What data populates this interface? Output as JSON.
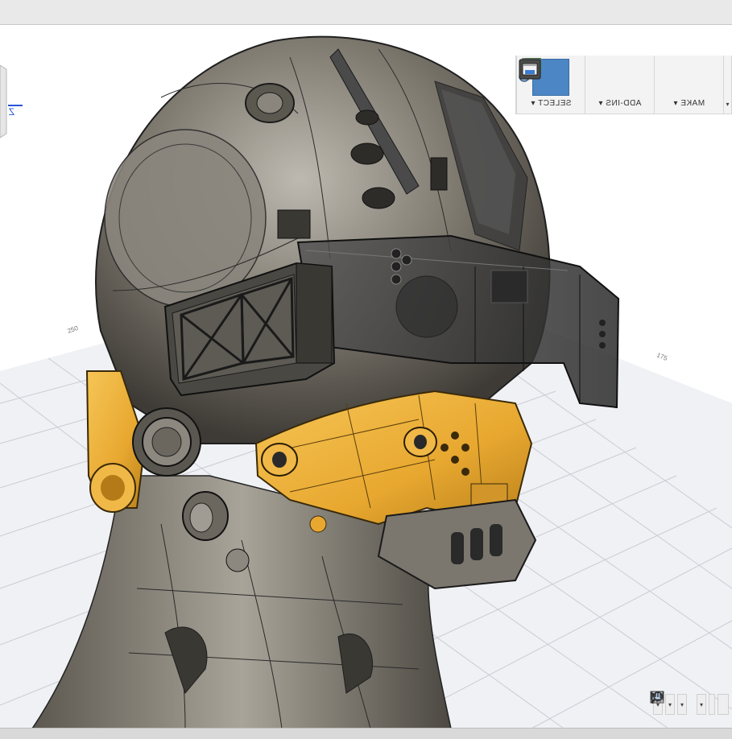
{
  "window": {
    "title": ""
  },
  "toolbar": {
    "groups": [
      {
        "label": "SELECT ▾",
        "icon": "select-arrow-icon",
        "active": true
      },
      {
        "label": "ADD-INS ▾",
        "icon": "add-ins-gear-icon",
        "active": false
      },
      {
        "label": "MAKE ▾",
        "icon": "make-3d-print-icon",
        "active": false
      }
    ]
  },
  "viewcube": {
    "axis_label": "Z"
  },
  "grid": {
    "labels": [
      "250",
      "175"
    ]
  },
  "model": {
    "name": ""
  },
  "colors": {
    "accent": "#4c86c4",
    "helmet_body": "#6e6a62",
    "orange_parts": "#e8a830",
    "visor": "#3a3a3a",
    "grid_line": "#c9ccd3"
  },
  "nav_bar": {
    "buttons": [
      {
        "icon": "pan-hand-icon"
      },
      {
        "icon": "zoom-icon"
      },
      {
        "icon": "fit-zoom-icon"
      },
      {
        "icon": "display-settings-icon"
      },
      {
        "icon": "grid-settings-icon"
      },
      {
        "icon": "viewports-icon"
      }
    ]
  }
}
